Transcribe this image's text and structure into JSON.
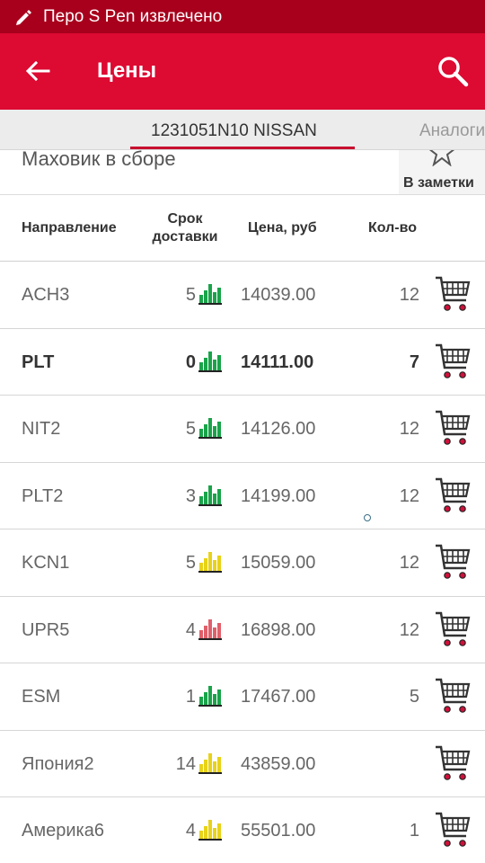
{
  "status_bar": {
    "notification": "Перо S Pen извлечено"
  },
  "app_bar": {
    "title": "Цены"
  },
  "tabs": [
    {
      "label": "1231051N10 NISSAN",
      "selected": true
    },
    {
      "label": "Аналоги",
      "selected": false
    }
  ],
  "part": {
    "name": "Маховик в сборе",
    "notes_label": "В заметки"
  },
  "table": {
    "headers": {
      "direction": "Направление",
      "term_line1": "Срок",
      "term_line2": "доставки",
      "price": "Цена, руб",
      "qty": "Кол-во"
    },
    "rows": [
      {
        "direction": "ACH3",
        "days": "5",
        "rating": "green",
        "price": "14039.00",
        "qty": "12",
        "bold": false
      },
      {
        "direction": "PLT",
        "days": "0",
        "rating": "green",
        "price": "14111.00",
        "qty": "7",
        "bold": true
      },
      {
        "direction": "NIT2",
        "days": "5",
        "rating": "green",
        "price": "14126.00",
        "qty": "12",
        "bold": false
      },
      {
        "direction": "PLT2",
        "days": "3",
        "rating": "green",
        "price": "14199.00",
        "qty": "12",
        "bold": false
      },
      {
        "direction": "KCN1",
        "days": "5",
        "rating": "yellow",
        "price": "15059.00",
        "qty": "12",
        "bold": false
      },
      {
        "direction": "UPR5",
        "days": "4",
        "rating": "red",
        "price": "16898.00",
        "qty": "12",
        "bold": false
      },
      {
        "direction": "ESM",
        "days": "1",
        "rating": "green",
        "price": "17467.00",
        "qty": "5",
        "bold": false
      },
      {
        "direction": "Япония2",
        "days": "14",
        "rating": "yellow",
        "price": "43859.00",
        "qty": "",
        "bold": false
      },
      {
        "direction": "Америка6",
        "days": "4",
        "rating": "yellow",
        "price": "55501.00",
        "qty": "1",
        "bold": false
      }
    ]
  },
  "colors": {
    "status_bar": "#a8001c",
    "app_bar": "#dd0a32",
    "accent": "#c8102e",
    "rating_green": "#1aa34a",
    "rating_yellow": "#e8d21a",
    "rating_red": "#e0606a"
  },
  "icons": {
    "status": "pen-icon",
    "back": "arrow-left-icon",
    "search": "search-icon",
    "notes": "star-icon",
    "rating": "bar-rating-icon",
    "cart": "cart-icon"
  }
}
